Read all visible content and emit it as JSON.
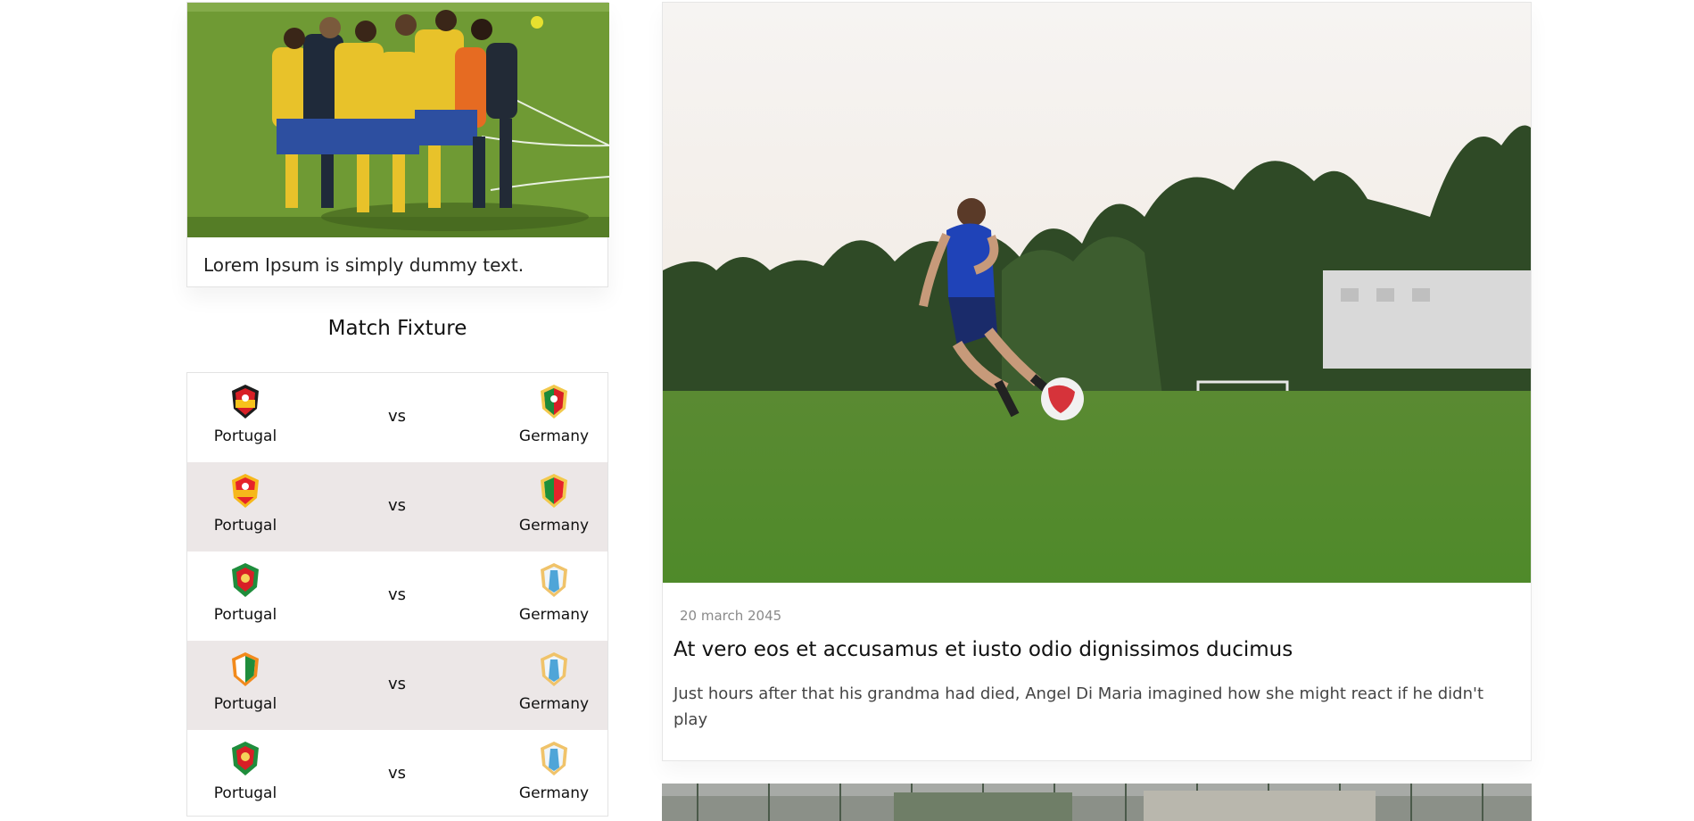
{
  "mini_card": {
    "photo_icon": "team-huddle-photo",
    "caption": "Lorem Ipsum is simply dummy text."
  },
  "fixture": {
    "title": "Match Fixture",
    "rows": [
      {
        "home": "Portugal",
        "vs": "vs",
        "away": "Germany",
        "home_colors": [
          "#d81f26",
          "#f7c21b"
        ],
        "away_colors": [
          "#d81f26",
          "#1c8a3a"
        ]
      },
      {
        "home": "Portugal",
        "vs": "vs",
        "away": "Germany",
        "home_colors": [
          "#e6232a",
          "#f6b81b"
        ],
        "away_colors": [
          "#e6232a",
          "#1d8f3a"
        ]
      },
      {
        "home": "Portugal",
        "vs": "vs",
        "away": "Germany",
        "home_colors": [
          "#1f8d3c",
          "#d81f26"
        ],
        "away_colors": [
          "#4fa5d8",
          "#f0c36a"
        ]
      },
      {
        "home": "Portugal",
        "vs": "vs",
        "away": "Germany",
        "home_colors": [
          "#f28a1c",
          "#1f8d3c"
        ],
        "away_colors": [
          "#4fa5d8",
          "#f0c36a"
        ]
      },
      {
        "home": "Portugal",
        "vs": "vs",
        "away": "Germany",
        "home_colors": [
          "#1f8d3c",
          "#d81f26"
        ],
        "away_colors": [
          "#4fa5d8",
          "#f0c36a"
        ]
      }
    ]
  },
  "article": {
    "photo_icon": "football-player-photo",
    "date": "20 march 2045",
    "headline": "At vero eos et accusamus et iusto odio dignissimos ducimus",
    "excerpt": "Just hours after that his grandma had died, Angel Di Maria imagined how she might react if he didn't play"
  },
  "next_article": {
    "photo_icon": "stadium-photo"
  }
}
